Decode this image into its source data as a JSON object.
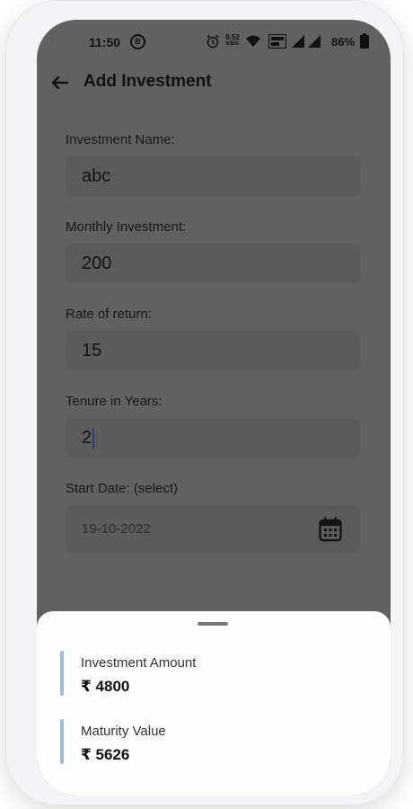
{
  "status_bar": {
    "time": "11:50",
    "badge": "B",
    "net_speed_value": "0.52",
    "net_speed_unit": "KB/S",
    "battery": "86%",
    "icons": [
      "alarm-icon",
      "wifi-icon",
      "wifi-calling-icon",
      "signal-icon",
      "signal-icon",
      "battery-icon"
    ]
  },
  "app_bar": {
    "title": "Add Investment",
    "back_icon": "arrow-left-icon"
  },
  "form": {
    "name_label": "Investment Name:",
    "name_value": "abc",
    "monthly_label": "Monthly Investment:",
    "monthly_value": "200",
    "rate_label": "Rate of return:",
    "rate_value": "15",
    "tenure_label": "Tenure in Years:",
    "tenure_value": "2",
    "start_date_label": "Start Date: (select)",
    "start_date_value": "19-10-2022",
    "calendar_icon": "calendar-icon"
  },
  "summary": {
    "investment_amount_label": "Investment Amount",
    "investment_amount_value": "₹ 4800",
    "maturity_label": "Maturity Value",
    "maturity_value": "₹ 5626"
  },
  "colors": {
    "overlay_bg": "#616161",
    "input_bg": "#5b5b5b",
    "sheet_bg": "#fdfdfd",
    "accent": "#a4b8e0",
    "caret": "#2d3b8e"
  }
}
